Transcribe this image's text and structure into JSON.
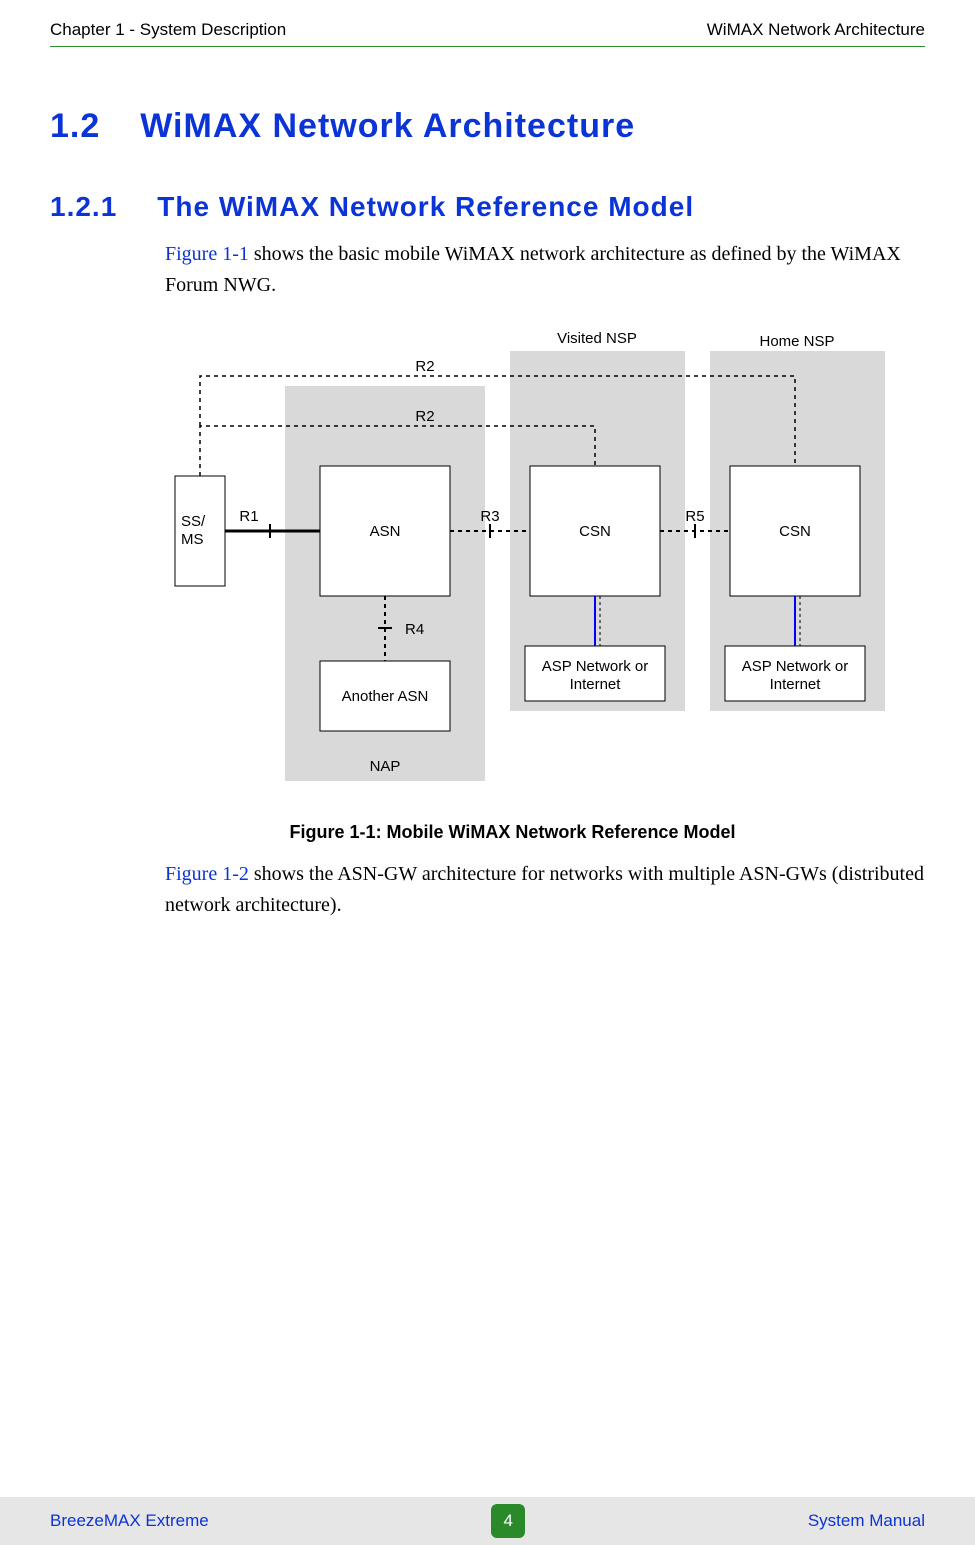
{
  "header": {
    "left": "Chapter 1 - System Description",
    "right": "WiMAX Network Architecture"
  },
  "headings": {
    "h2_num": "1.2",
    "h2_title": "WiMAX Network Architecture",
    "h3_num": "1.2.1",
    "h3_title": "The WiMAX Network Reference Model"
  },
  "para1": {
    "ref": "Figure 1-1",
    "rest": " shows the basic mobile WiMAX network architecture as defined by the WiMAX Forum NWG."
  },
  "figure": {
    "caption": "Figure 1-1: Mobile WiMAX Network Reference Model",
    "labels": {
      "visited_nsp": "Visited NSP",
      "home_nsp": "Home NSP",
      "nap": "NAP",
      "ssms": "SS/\nMS",
      "asn": "ASN",
      "csn1": "CSN",
      "csn2": "CSN",
      "another_asn": "Another ASN",
      "asp1_l1": "ASP Network or",
      "asp1_l2": "Internet",
      "asp2_l1": "ASP Network  or",
      "asp2_l2": "Internet",
      "r1": "R1",
      "r2a": "R2",
      "r2b": "R2",
      "r3": "R3",
      "r4": "R4",
      "r5": "R5"
    }
  },
  "para2": {
    "ref": "Figure 1-2",
    "rest": " shows the ASN-GW architecture for networks with multiple ASN-GWs (distributed network architecture)."
  },
  "footer": {
    "left": "BreezeMAX Extreme",
    "page": "4",
    "right": "System Manual"
  }
}
